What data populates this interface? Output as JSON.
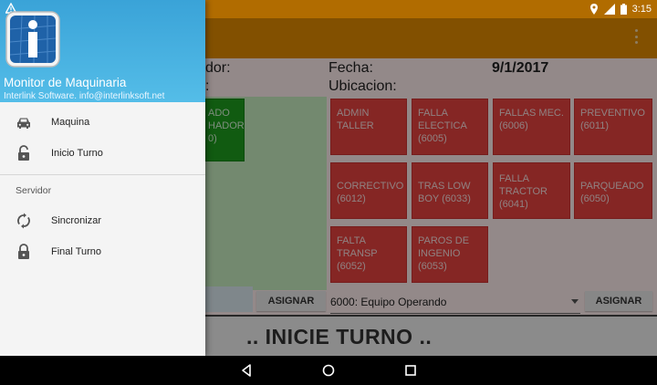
{
  "status_bar": {
    "time": "3:15"
  },
  "content": {
    "label_left_1": "dor:",
    "label_left_2": ":",
    "fecha_label": "Fecha:",
    "fecha_value": "9/1/2017",
    "ubicacion_label": "Ubicacion:",
    "green_tile": {
      "line1": "ADO",
      "line2": "HADOR",
      "line3": "0)"
    },
    "tiles": [
      {
        "text": "ADMIN TALLER"
      },
      {
        "text": "FALLA ELECTICA (6005)"
      },
      {
        "text": "FALLAS MEC. (6006)"
      },
      {
        "text": "PREVENTIVO (6011)"
      },
      {
        "text": "CORRECTIVO (6012)"
      },
      {
        "text": "TRAS LOW BOY (6033)"
      },
      {
        "text": "FALLA TRACTOR (6041)"
      },
      {
        "text": "PARQUEADO (6050)"
      },
      {
        "text": "FALTA TRANSP (6052)"
      },
      {
        "text": "PAROS DE INGENIO (6053)"
      }
    ],
    "assign_left_label": "ASIGNAR",
    "spinner_value": "6000: Equipo Operando",
    "assign_right_label": "ASIGNAR",
    "banner": ".. INICIE TURNO .."
  },
  "drawer": {
    "title": "Monitor de Maquinaria",
    "subtitle": "Interlink Software. info@interlinksoft.net",
    "items": [
      {
        "label": "Maquina",
        "icon": "car-icon"
      },
      {
        "label": "Inicio Turno",
        "icon": "unlock-icon"
      }
    ],
    "section_label": "Servidor",
    "server_items": [
      {
        "label": "Sincronizar",
        "icon": "sync-icon"
      },
      {
        "label": "Final Turno",
        "icon": "lock-icon"
      }
    ]
  },
  "colors": {
    "appbar": "#e08a00",
    "tile_red": "#e6423f",
    "tile_green": "#1e9d1e",
    "drawer_header": "#3aa3d8"
  }
}
